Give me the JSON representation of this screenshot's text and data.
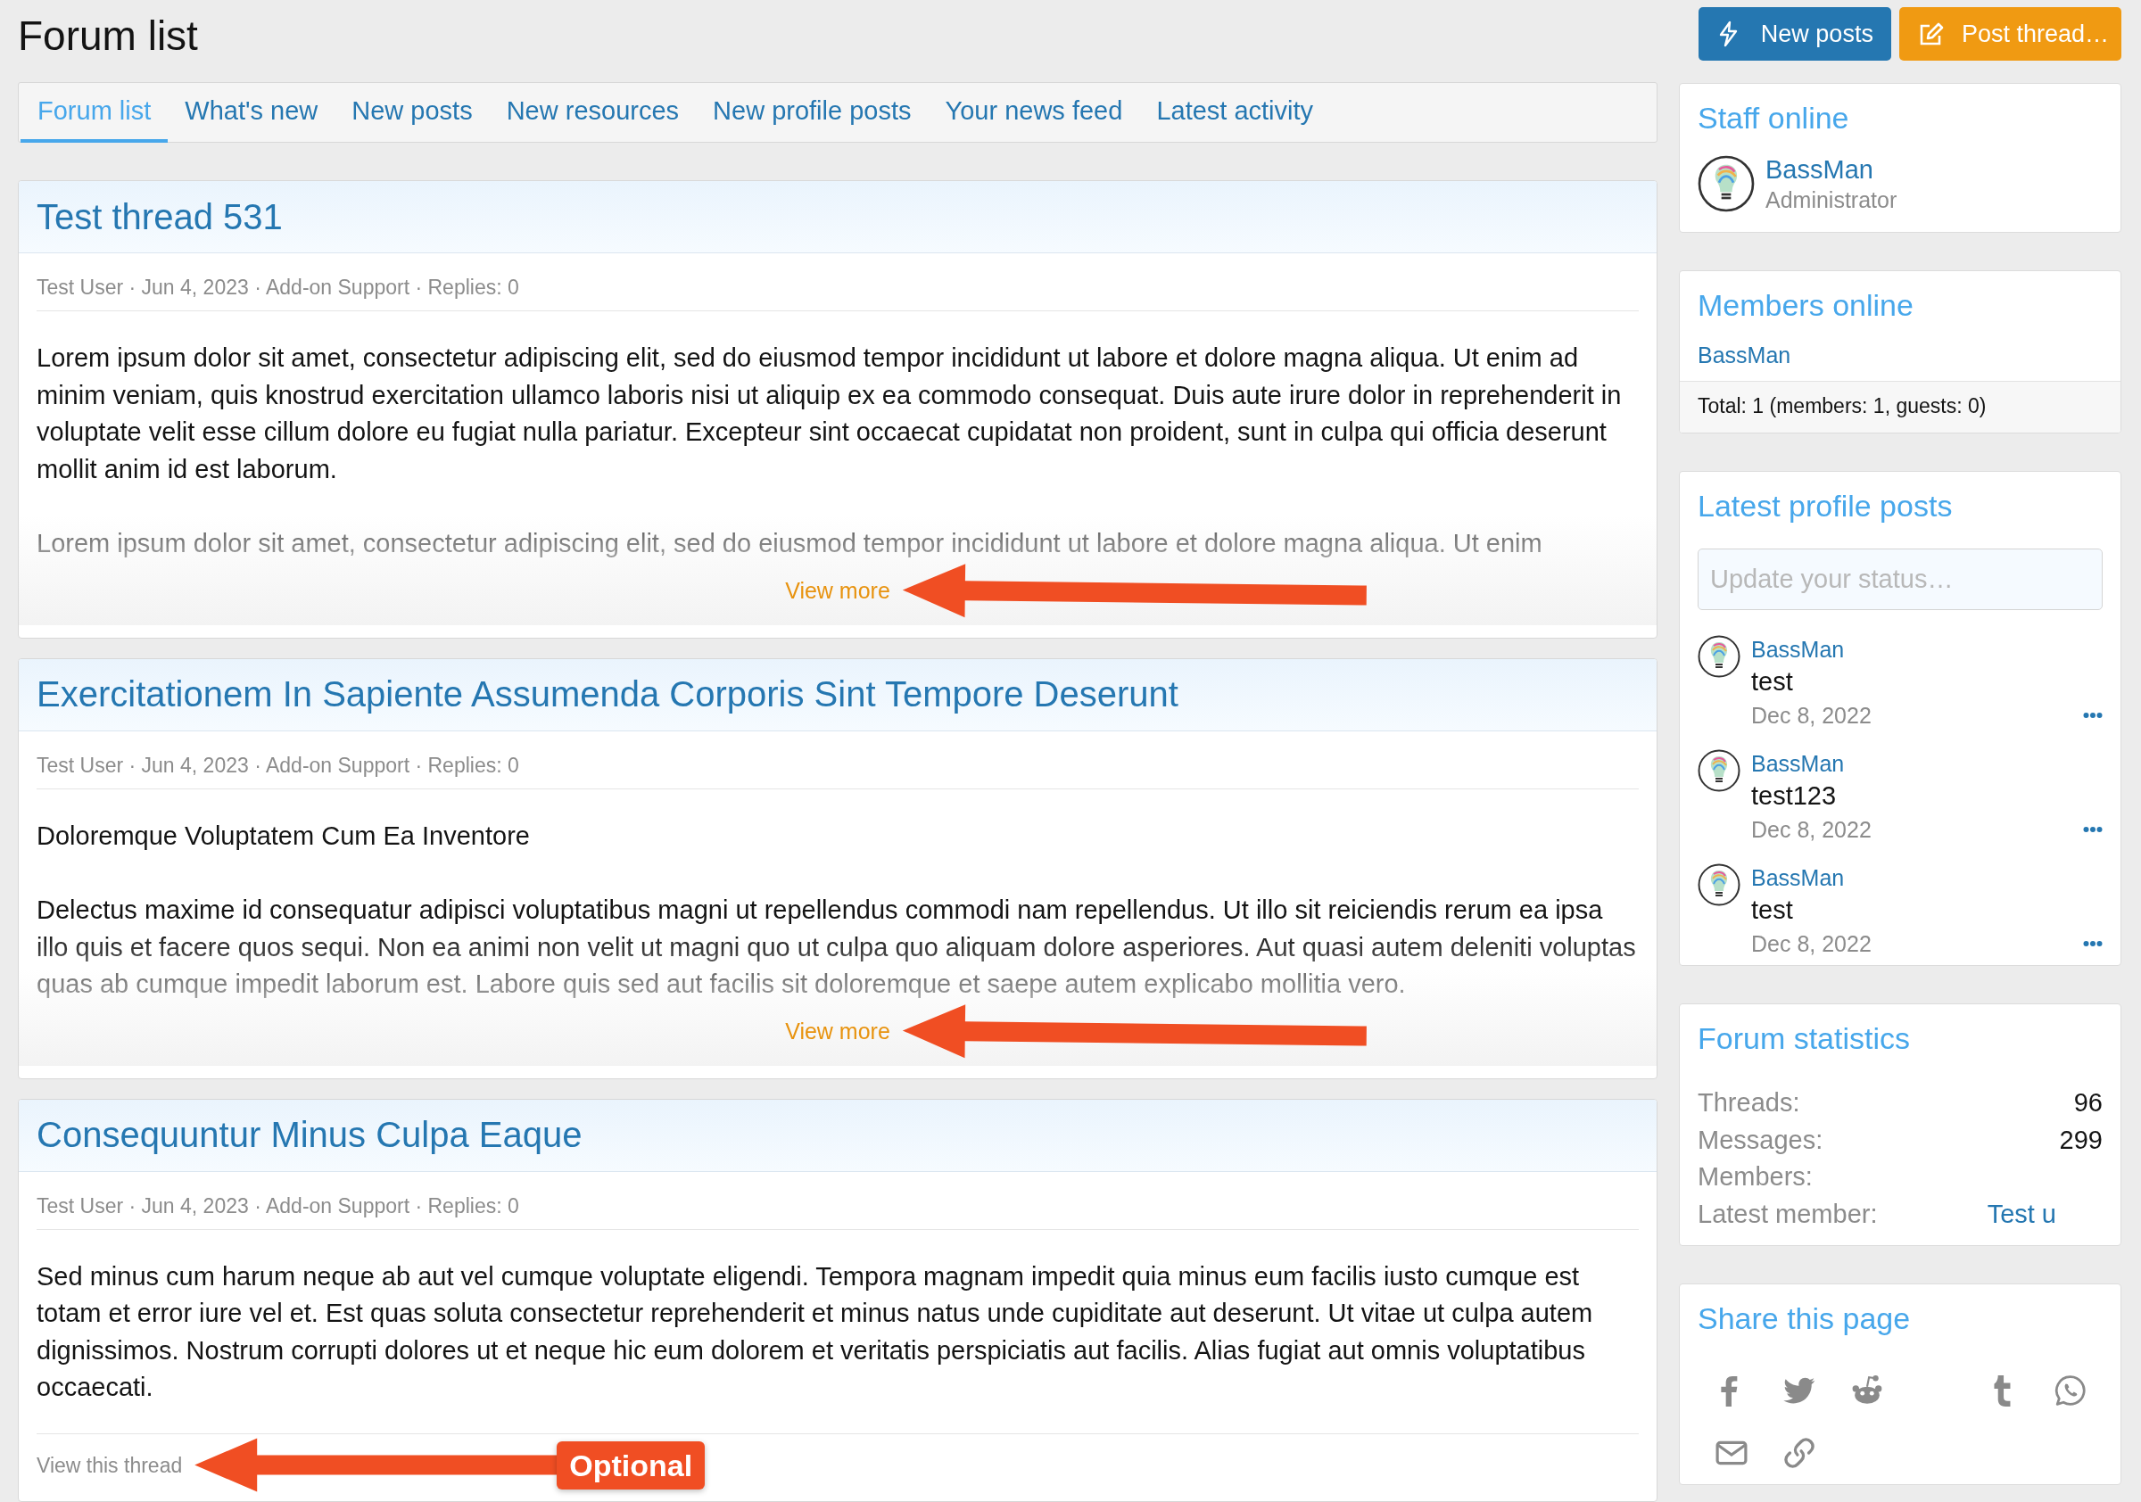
{
  "page_title": "Forum list",
  "actions": [
    {
      "kind": "new_posts",
      "label": "New posts"
    },
    {
      "kind": "post_thread",
      "label": "Post thread…"
    }
  ],
  "tabs": [
    {
      "label": "Forum list",
      "selected": true
    },
    {
      "label": "What's new",
      "selected": false
    },
    {
      "label": "New posts",
      "selected": false
    },
    {
      "label": "New resources",
      "selected": false
    },
    {
      "label": "New profile posts",
      "selected": false
    },
    {
      "label": "Your news feed",
      "selected": false
    },
    {
      "label": "Latest activity",
      "selected": false
    }
  ],
  "posts": [
    {
      "kind": "preview",
      "title": "Test thread 531",
      "meta": "Test User · Jun 4, 2023 · Add-on Support · Replies: 0",
      "paragraphs": [
        "Lorem ipsum dolor sit amet, consectetur adipiscing elit, sed do eiusmod tempor incididunt ut labore et dolore magna aliqua. Ut enim ad minim veniam, quis knostrud exercitation ullamco laboris nisi ut aliquip ex ea commodo consequat. Duis aute irure dolor in reprehenderit in voluptate velit esse cillum dolore eu fugiat nulla pariatur. Excepteur sint occaecat cupidatat non proident, sunt in culpa qui officia deserunt mollit anim id est laborum.",
        "Lorem ipsum dolor sit amet, consectetur adipiscing elit, sed do eiusmod tempor incididunt ut labore et dolore magna aliqua. Ut enim"
      ],
      "link": "View more"
    },
    {
      "kind": "preview",
      "title": "Exercitationem In Sapiente Assumenda Corporis Sint Tempore Deserunt",
      "meta": "Test User · Jun 4, 2023 · Add-on Support · Replies: 0",
      "paragraphs": [
        "Doloremque Voluptatem Cum Ea Inventore",
        "Delectus maxime id consequatur adipisci voluptatibus magni ut repellendus commodi nam repellendus. Ut illo sit reiciendis rerum ea ipsa illo quis et facere quos sequi. Non ea animi non velit ut magni quo ut culpa quo aliquam dolore asperiores. Aut quasi autem deleniti voluptas quas ab cumque impedit laborum est. Labore quis sed aut facilis sit doloremque et saepe autem explicabo mollitia vero."
      ],
      "link": "View more"
    },
    {
      "kind": "full",
      "title": "Consequuntur Minus Culpa Eaque",
      "meta": "Test User · Jun 4, 2023 · Add-on Support · Replies: 0",
      "paragraphs": [
        "Sed minus cum harum neque ab aut vel cumque voluptate eligendi. Tempora magnam impedit quia minus eum facilis iusto cumque est totam et error iure vel et. Est quas soluta consectetur reprehenderit et minus natus unde cupiditate aut deserunt. Ut vitae ut culpa autem dignissimos. Nostrum corrupti dolores ut et neque hic eum dolorem et veritatis perspiciatis aut facilis. Alias fugiat aut omnis voluptatibus occaecati."
      ],
      "link": "View this thread"
    }
  ],
  "annotation": {
    "label": "Optional"
  },
  "sidebar": {
    "staff_online": {
      "title": "Staff online",
      "members": [
        {
          "name": "BassMan",
          "role": "Administrator"
        }
      ]
    },
    "members_online": {
      "title": "Members online",
      "members": [
        "BassMan"
      ],
      "total": "Total: 1 (members: 1, guests: 0)"
    },
    "profile_posts": {
      "title": "Latest profile posts",
      "placeholder": "Update your status…",
      "posts": [
        {
          "author": "BassMan",
          "message": "test",
          "date": "Dec 8, 2022"
        },
        {
          "author": "BassMan",
          "message": "test123",
          "date": "Dec 8, 2022"
        },
        {
          "author": "BassMan",
          "message": "test",
          "date": "Dec 8, 2022"
        }
      ]
    },
    "statistics": {
      "title": "Forum statistics",
      "rows": [
        {
          "kind": "number",
          "label": "Threads:",
          "value": "96"
        },
        {
          "kind": "number",
          "label": "Messages:",
          "value": "299"
        },
        {
          "kind": "number",
          "label": "Members:"
        },
        {
          "kind": "link",
          "label": "Latest member:",
          "value": "Test u"
        }
      ]
    },
    "share": {
      "title": "Share this page",
      "services": [
        {
          "kind": "facebook"
        },
        {
          "kind": "twitter"
        },
        {
          "kind": "reddit"
        },
        {
          "kind": "tumblr"
        },
        {
          "kind": "whatsapp"
        },
        {
          "kind": "email"
        },
        {
          "kind": "link"
        }
      ]
    }
  }
}
